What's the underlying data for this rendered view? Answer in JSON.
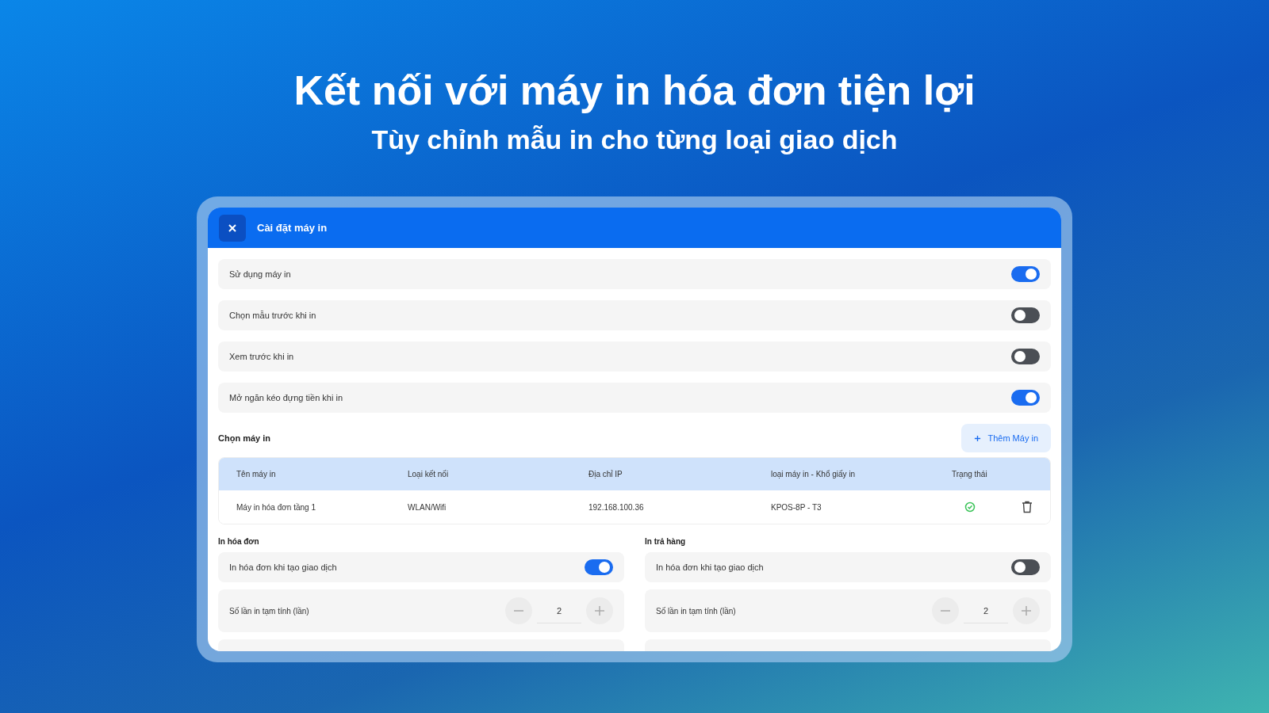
{
  "headline": "Kết nối với máy in hóa đơn tiện lợi",
  "subheadline": "Tùy chỉnh mẫu in cho từng loại giao dịch",
  "window": {
    "title": "Cài đặt máy in"
  },
  "settings": [
    {
      "label": "Sử dụng máy in",
      "on": true
    },
    {
      "label": "Chọn mẫu trước khi in",
      "on": false
    },
    {
      "label": "Xem trước khi in",
      "on": false
    },
    {
      "label": "Mở ngăn kéo đựng tiền khi in",
      "on": true
    }
  ],
  "printers": {
    "title": "Chọn máy in",
    "add_button": "Thêm Máy in",
    "columns": [
      "Tên máy in",
      "Loại kết nối",
      "Địa chỉ IP",
      "loại máy in - Khổ giấy in",
      "Trạng thái"
    ],
    "rows": [
      {
        "cells": [
          "Máy in hóa đơn tầng 1",
          "WLAN/Wifi",
          "192.168.100.36",
          "KPOS-8P - T3"
        ],
        "connected": true
      }
    ]
  },
  "sections": [
    {
      "title": "In hóa đơn",
      "toggle": {
        "label": "In hóa đơn khi tạo giao dịch",
        "on": true
      },
      "counter": {
        "label": "Số lần in tạm tính (lần)",
        "value": "2"
      }
    },
    {
      "title": "In trả hàng",
      "toggle": {
        "label": "In hóa đơn khi tạo giao dịch",
        "on": false
      },
      "counter": {
        "label": "Số lần in tạm tính (lần)",
        "value": "2"
      }
    }
  ]
}
